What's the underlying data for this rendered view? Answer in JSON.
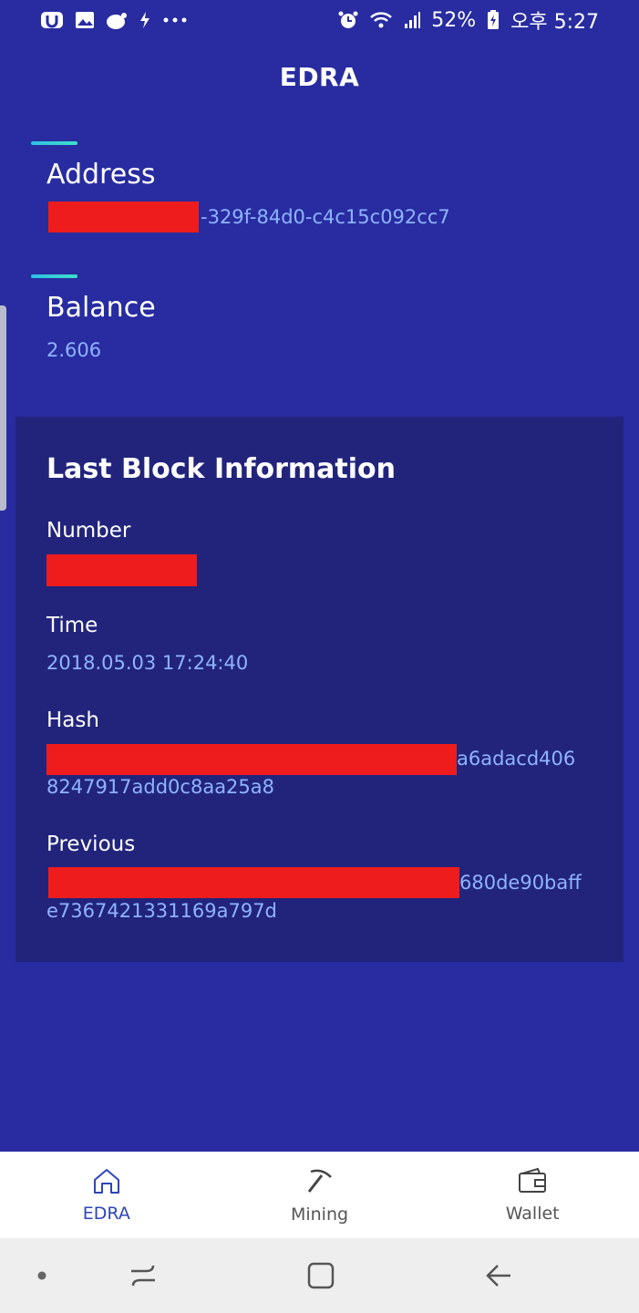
{
  "status_bar": {
    "left_icons": [
      "u-app-icon",
      "gallery-icon",
      "cup-icon",
      "flash-icon",
      "more-dots-icon"
    ],
    "battery_percent": "52%",
    "time": "오후 5:27",
    "right_icons": [
      "alarm-icon",
      "wifi-icon",
      "signal-icon",
      "battery-icon"
    ]
  },
  "header": {
    "title": "EDRA"
  },
  "address": {
    "label": "Address",
    "value": "-329f-84d0-c4c15c092cc7"
  },
  "balance": {
    "label": "Balance",
    "value": "2.606"
  },
  "last_block": {
    "title": "Last Block Information",
    "number": {
      "label": "Number"
    },
    "time": {
      "label": "Time",
      "value": "2018.05.03 17:24:40"
    },
    "hash": {
      "label": "Hash",
      "line1_tail": "a6adacd406",
      "line2": "8247917add0c8aa25a8"
    },
    "previous": {
      "label": "Previous",
      "line1_tail": "680de90baff",
      "line2": "e7367421331169a797d"
    }
  },
  "bottom_nav": {
    "items": [
      {
        "label": "EDRA",
        "icon": "home-icon",
        "active": true
      },
      {
        "label": "Mining",
        "icon": "pickaxe-icon",
        "active": false
      },
      {
        "label": "Wallet",
        "icon": "wallet-icon",
        "active": false
      }
    ]
  },
  "system_nav": {
    "icons": [
      "dot-icon",
      "recents-icon",
      "home-square-icon",
      "back-icon"
    ]
  },
  "colors": {
    "background": "#282ca0",
    "card": "#22247c",
    "value_text": "#8fb4ff",
    "accent": "#2ec0e6",
    "active_nav": "#2e45b8",
    "redaction": "#ee1c1c"
  }
}
